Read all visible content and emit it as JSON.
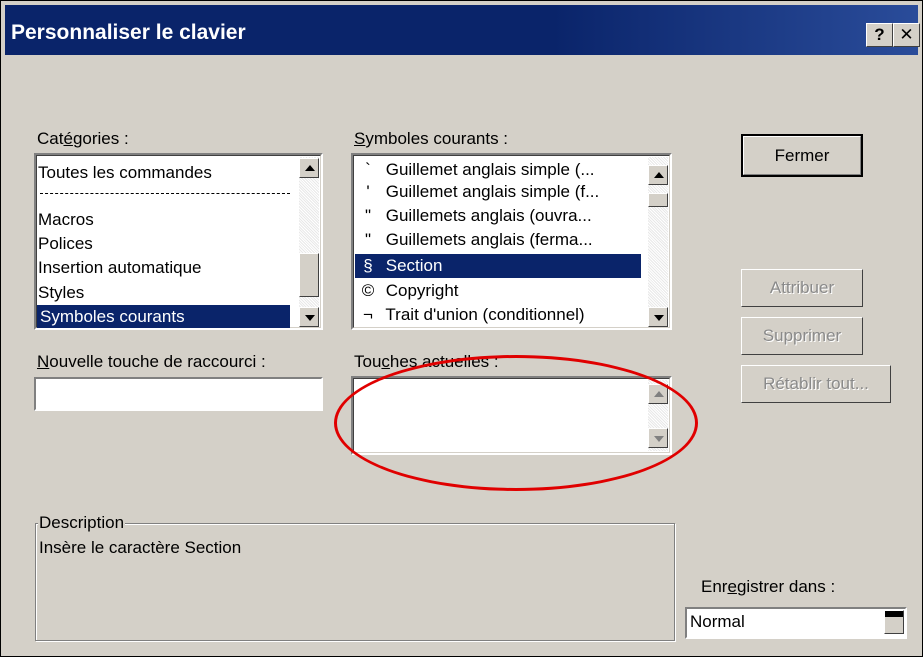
{
  "dialog": {
    "title": "Personnaliser le clavier",
    "help_label": "?",
    "close_label": "✕"
  },
  "categories": {
    "label_pre": "Cat",
    "label_accel": "é",
    "label_post": "gories :",
    "items": [
      "Toutes les commandes",
      "Macros",
      "Polices",
      "Insertion automatique",
      "Styles",
      "Symboles courants"
    ],
    "selected": "Symboles courants"
  },
  "symbols": {
    "label_accel": "S",
    "label_post": "ymboles courants :",
    "items": [
      {
        "glyph": "`",
        "text": "Guillemet anglais simple (..."
      },
      {
        "glyph": "'",
        "text": "Guillemet anglais simple (f..."
      },
      {
        "glyph": "\"",
        "text": "Guillemets anglais (ouvra..."
      },
      {
        "glyph": "\"",
        "text": "Guillemets anglais (ferma..."
      },
      {
        "glyph": "§",
        "text": "Section"
      },
      {
        "glyph": "©",
        "text": "Copyright"
      },
      {
        "glyph": "¬",
        "text": "Trait d'union (conditionnel)"
      }
    ],
    "selected": "Section"
  },
  "new_shortcut": {
    "label_accel": "N",
    "label_post": "ouvelle touche de raccourci :",
    "value": ""
  },
  "current_keys": {
    "label_pre": "Tou",
    "label_accel": "c",
    "label_post": "hes actuelles :"
  },
  "buttons": {
    "close": "Fermer",
    "assign": "Attribuer",
    "remove": "Supprimer",
    "reset_all": "Rétablir tout..."
  },
  "description": {
    "label": "Description",
    "text": "Insère le caractère Section"
  },
  "save_in": {
    "label_pre": "Enr",
    "label_accel": "e",
    "label_post": "gistrer dans :",
    "value": "Normal"
  },
  "colors": {
    "titlebar": "#0a246a",
    "selection": "#0a246a",
    "annotation": "#e00000",
    "face": "#d4d0c8"
  }
}
